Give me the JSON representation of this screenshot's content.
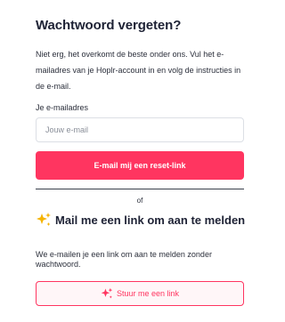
{
  "forgot": {
    "title": "Wachtwoord vergeten?",
    "description": "Niet erg, het overkomt de beste onder ons. Vul het e-mailadres van je Hoplr-account in en volg de instructies in de e-mail.",
    "email_label": "Je e-mailadres",
    "email_placeholder": "Jouw e-mail",
    "email_value": "",
    "reset_button": "E-mail mij een reset-link"
  },
  "divider_text": "of",
  "magic_link": {
    "icon": "sparkles-icon",
    "title": "Mail me een link om aan te melden",
    "description": "We e-mailen je een link om aan te melden zonder wachtwoord.",
    "button": "Stuur me een link"
  },
  "colors": {
    "primary": "#ff3560",
    "sparkle_yellow": "#f5b301",
    "text_dark": "#1e2235"
  }
}
